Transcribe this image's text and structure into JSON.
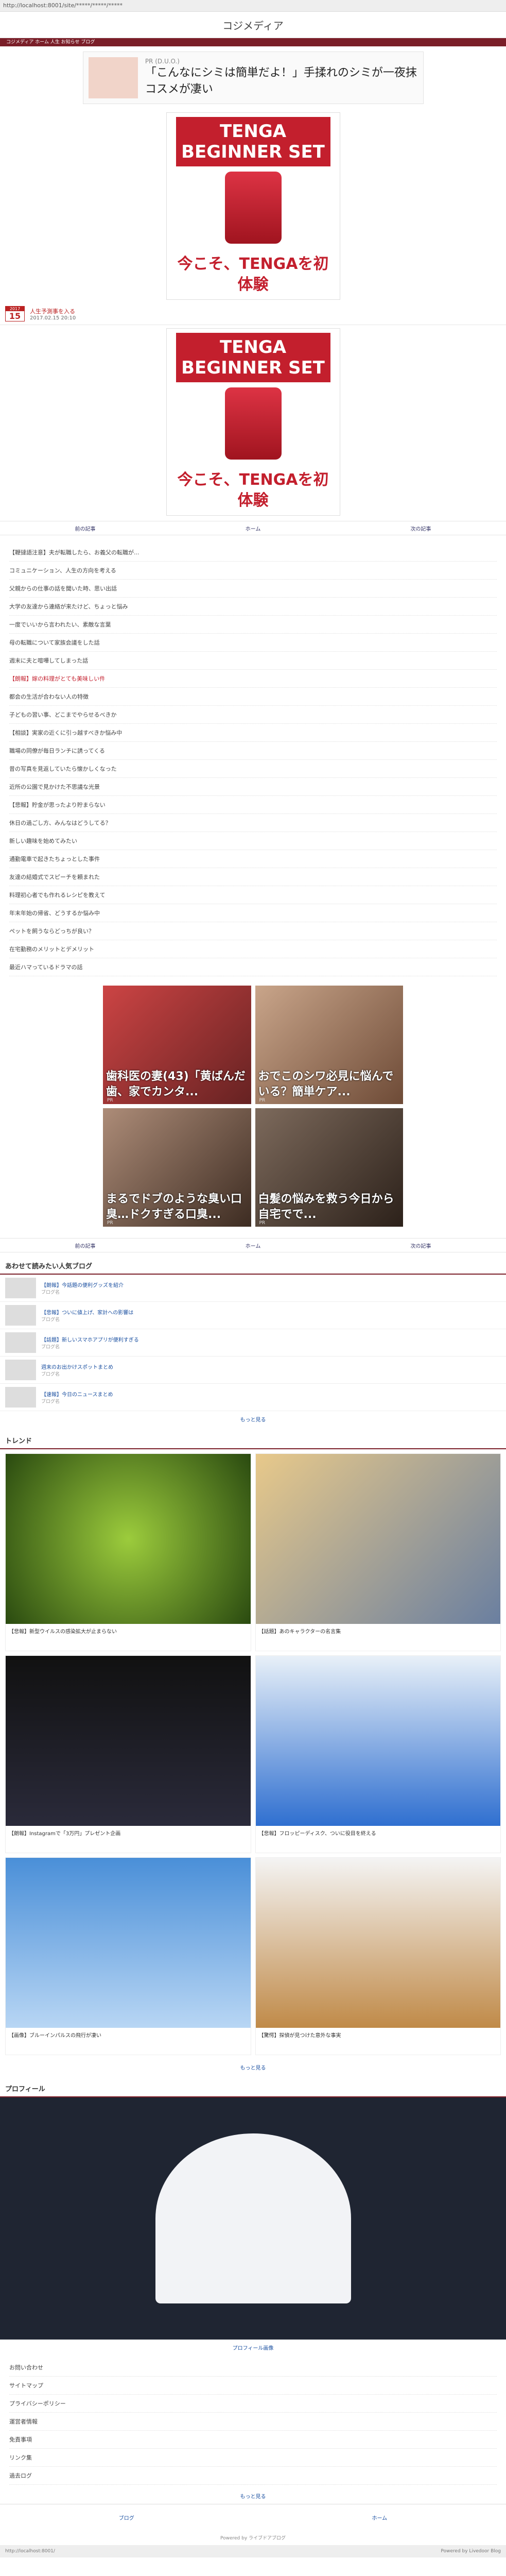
{
  "browser": {
    "url": "http://localhost:8001/site/*****/*****/*****"
  },
  "site": {
    "logo": "コジメディア"
  },
  "nav": {
    "text": "コジメディア ホーム  人生  お知らせ  ブログ"
  },
  "ad": {
    "pr": "PR (D.U.O.)",
    "text": "「こんなにシミは簡単だよ！」手揉れのシミが一夜抹コスメが凄い"
  },
  "tenga1": {
    "top": "TENGA BEGINNER SET",
    "mid": "今こそ、TENGAを初体験"
  },
  "tenga2": {
    "top": "TENGA BEGINNER SET",
    "mid": "今こそ、TENGAを初体験"
  },
  "post": {
    "month": "2017",
    "day": "15",
    "title": "人生予測事を入る",
    "meta": "2017.02.15 20:10"
  },
  "pager": {
    "prev": "前の記事",
    "center": "ホーム",
    "next": "次の記事"
  },
  "lines": [
    "【鞭撻語注意】夫が転職したら、お義父の転職が...",
    "コミュニケーション、人生の方向を考える",
    "父親からの仕事の話を聞いた時、思い出話",
    "大学の友達から連絡が来たけど、ちょっと悩み",
    "一度でいいから言われたい、素敵な言葉",
    "母の転職について家族会議をした話",
    "週末に夫と喧嘩してしまった話",
    "【朗報】嫁の料理がとても美味しい件",
    "都会の生活が合わない人の特徴",
    "子どもの習い事、どこまでやらせるべきか",
    "【相談】実家の近くに引っ越すべきか悩み中",
    "職場の同僚が毎日ランチに誘ってくる",
    "昔の写真を見返していたら懐かしくなった",
    "近所の公園で見かけた不思議な光景",
    "【悲報】貯金が思ったより貯まらない",
    "休日の過ごし方、みんなはどうしてる？",
    "新しい趣味を始めてみたい",
    "通勤電車で起きたちょっとした事件",
    "友達の結婚式でスピーチを頼まれた",
    "料理初心者でも作れるレシピを教えて",
    "年末年始の帰省、どうするか悩み中",
    "ペットを飼うならどっちが良い？",
    "在宅勤務のメリットとデメリット",
    "最近ハマっているドラマの話"
  ],
  "tiles": [
    {
      "label": "歯科医の妻(43)「黄ばんだ歯、家でカンタ...",
      "sub": "PR"
    },
    {
      "label": "おでこのシワ必見に悩んでいる？簡単ケア...",
      "sub": "PR"
    },
    {
      "label": "まるでドブのような臭い口臭…ドクすぎる口臭...",
      "sub": "PR"
    },
    {
      "label": "白髪の悩みを救う今日から自宅でで...",
      "sub": "PR"
    }
  ],
  "pager2": {
    "prev": "前の記事",
    "center": "ホーム",
    "next": "次の記事"
  },
  "ranking": {
    "head": "あわせて読みたい人気ブログ",
    "items": [
      {
        "title": "【朗報】今話題の便利グッズを紹介",
        "sub": "ブログ名"
      },
      {
        "title": "【悲報】ついに値上げ、家計への影響は",
        "sub": "ブログ名"
      },
      {
        "title": "【話題】新しいスマホアプリが便利すぎる",
        "sub": "ブログ名"
      },
      {
        "title": "週末のお出かけスポットまとめ",
        "sub": "ブログ名"
      },
      {
        "title": "【速報】今日のニュースまとめ",
        "sub": "ブログ名"
      }
    ],
    "more": "もっと見る"
  },
  "trend": {
    "head": "トレンド",
    "items": [
      {
        "cap": "【悲報】新型ウイルスの感染拡大が止まらない"
      },
      {
        "cap": "【話題】あのキャラクターの名言集"
      },
      {
        "cap": "【朗報】Instagramで「3万円」プレゼント企画"
      },
      {
        "cap": "【悲報】フロッピーディスク、ついに役目を終える"
      },
      {
        "cap": "【画像】ブルーインパルスの飛行が凄い"
      },
      {
        "cap": "【驚愕】探偵が見つけた意外な事実"
      }
    ],
    "more": "もっと見る"
  },
  "profile": {
    "head": "プロフィール",
    "caption": "プロフィール画像",
    "more": "もっと見る"
  },
  "links": [
    "お問い合わせ",
    "サイトマップ",
    "プライバシーポリシー",
    "運営者情報",
    "免責事項",
    "リンク集",
    "過去ログ"
  ],
  "footerNav": {
    "left": "ブログ",
    "right": "ホーム"
  },
  "foot": {
    "text": "Powered by ライブドアブログ"
  },
  "bottom": {
    "left": "http://localhost:8001/",
    "right": "Powered by Livedoor Blog"
  }
}
